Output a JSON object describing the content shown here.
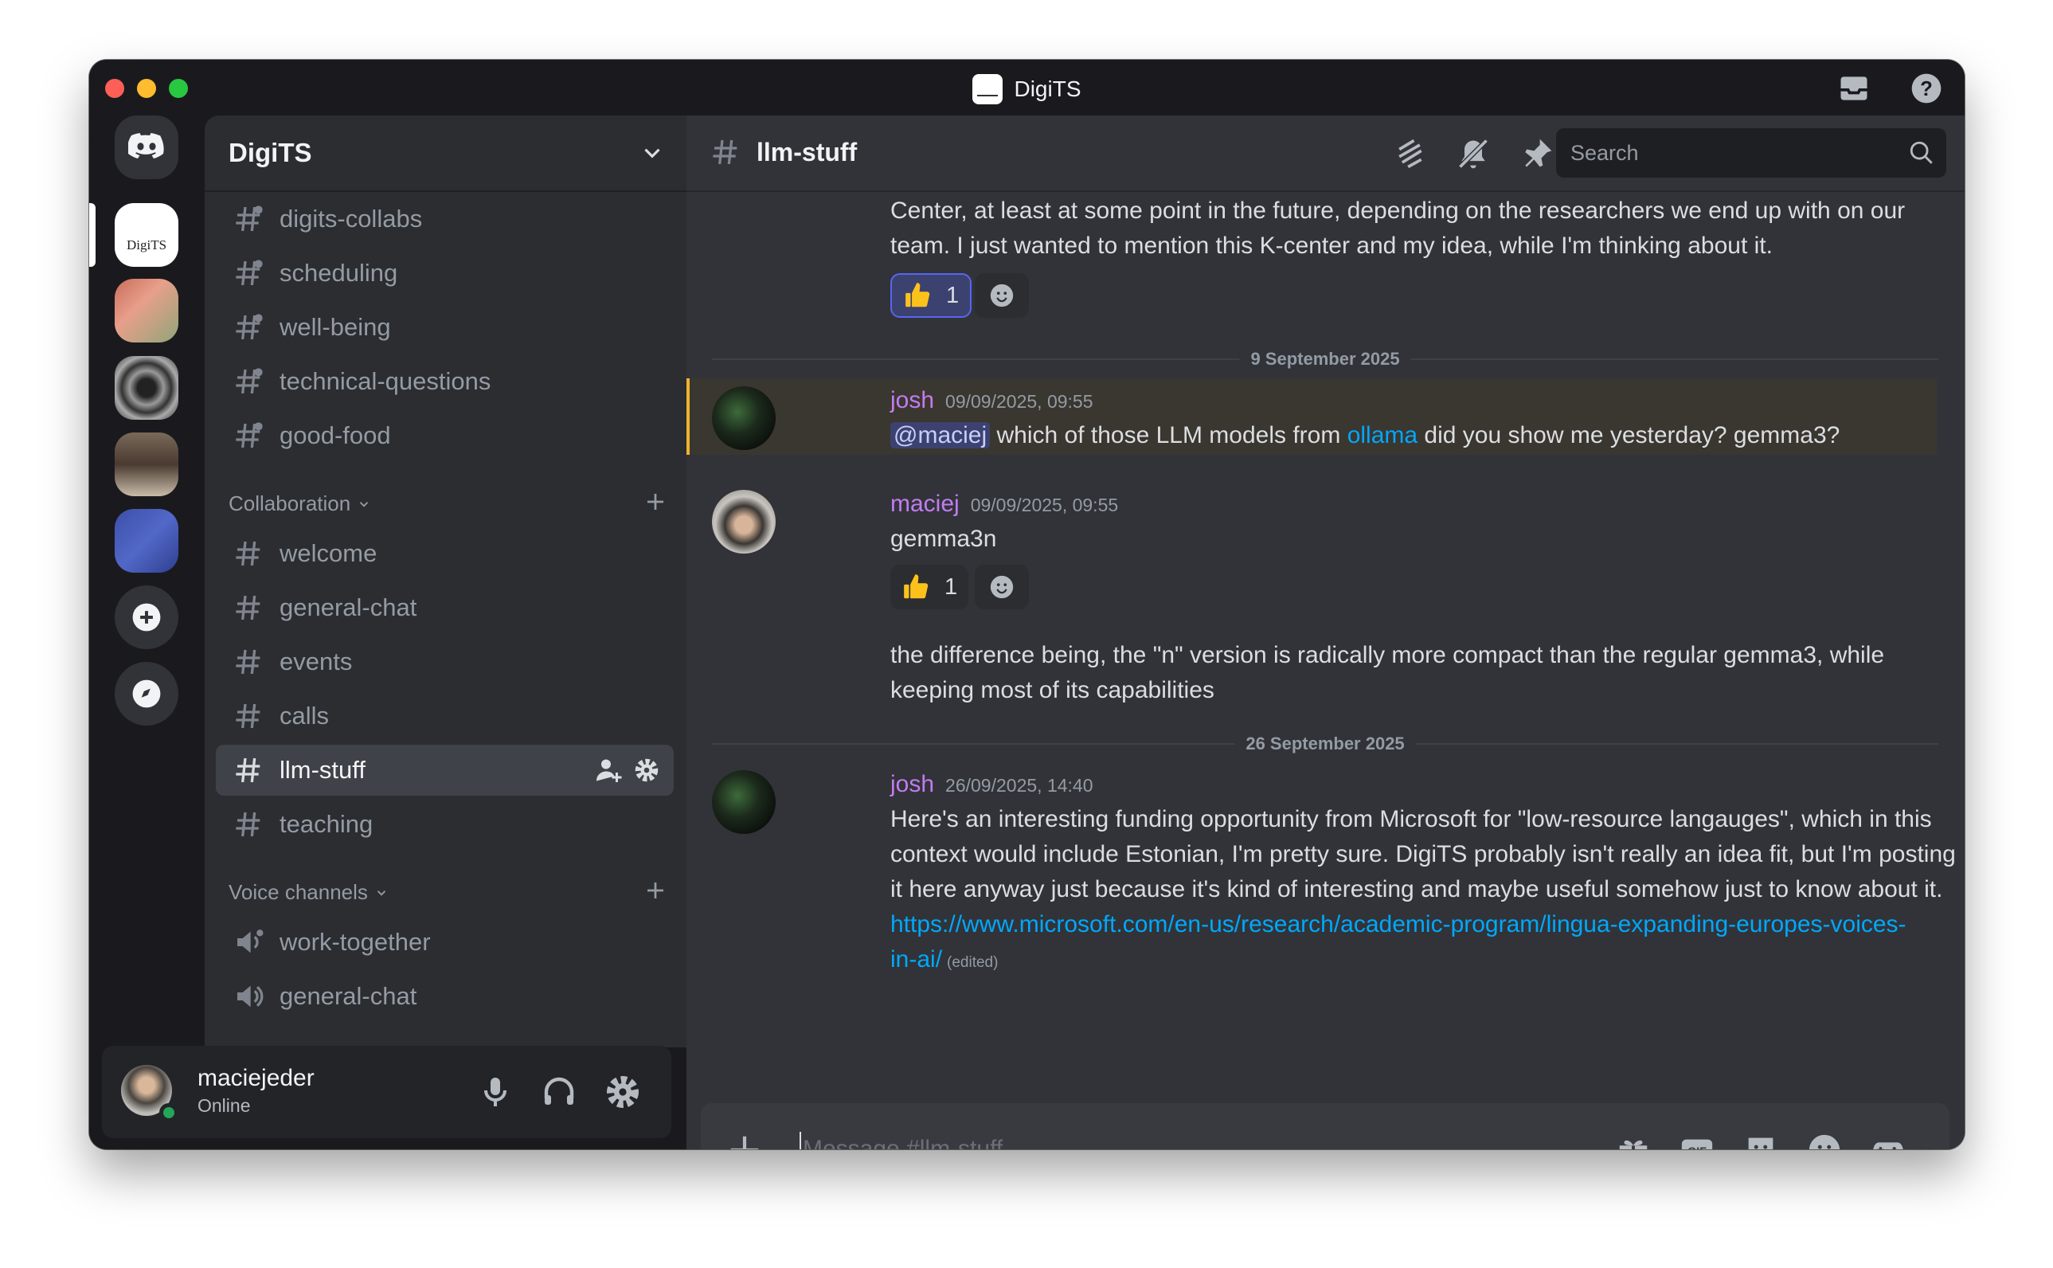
{
  "app": {
    "title": "DigiTS"
  },
  "server": {
    "name": "DigiTS"
  },
  "channels_top": [
    {
      "name": "digits-collabs"
    },
    {
      "name": "scheduling"
    },
    {
      "name": "well-being"
    },
    {
      "name": "technical-questions"
    },
    {
      "name": "good-food"
    }
  ],
  "categories": {
    "collaboration": "Collaboration",
    "voice": "Voice channels"
  },
  "channels_collab": [
    {
      "name": "welcome"
    },
    {
      "name": "general-chat"
    },
    {
      "name": "events"
    },
    {
      "name": "calls"
    },
    {
      "name": "llm-stuff"
    },
    {
      "name": "teaching"
    }
  ],
  "voice_channels": [
    {
      "name": "work-together"
    },
    {
      "name": "general-chat"
    }
  ],
  "user": {
    "name": "maciejeder",
    "status": "Online"
  },
  "header": {
    "channel": "llm-stuff",
    "search_placeholder": "Search"
  },
  "messages": {
    "partial": {
      "line1": "Center, at least at some point in the future, depending on the researchers we end up with on our",
      "line2": "team. I just wanted to mention this K-center and my idea, while I'm thinking about it.",
      "reaction_count": "1"
    },
    "divider1": "9 September 2025",
    "m1": {
      "author": "josh",
      "time": "09/09/2025, 09:55",
      "mention": "@maciej",
      "text_a": " which of those LLM models from ",
      "link": "ollama",
      "text_b": " did you show me yesterday? gemma3?"
    },
    "m2": {
      "author": "maciej",
      "time": "09/09/2025, 09:55",
      "text": "gemma3n",
      "reaction_count": "1",
      "followup_line1": "the difference being, the \"n\" version is radically more compact than the regular gemma3, while",
      "followup_line2": "keeping most of its capabilities"
    },
    "divider2": "26 September 2025",
    "m3": {
      "author": "josh",
      "time": "26/09/2025, 14:40",
      "line1": "Here's an interesting funding opportunity from Microsoft for \"low-resource langauges\", which in this",
      "line2": "context would include Estonian, I'm pretty sure. DigiTS probably isn't really an idea fit, but I'm posting",
      "line3": "it here anyway just because it's kind of interesting and maybe useful somehow just to know about it.",
      "link1": "https://www.microsoft.com/en-us/research/academic-program/lingua-expanding-europes-voices-",
      "link2": "in-ai/",
      "edited": "(edited)"
    }
  },
  "composer": {
    "placeholder": "Message #llm-stuff"
  },
  "icons": {
    "server_logo_text": "DigiTS"
  },
  "colors": {
    "accent": "#5865f2",
    "username": "#c27cf0",
    "link": "#00a8fc",
    "online": "#23a55a"
  }
}
